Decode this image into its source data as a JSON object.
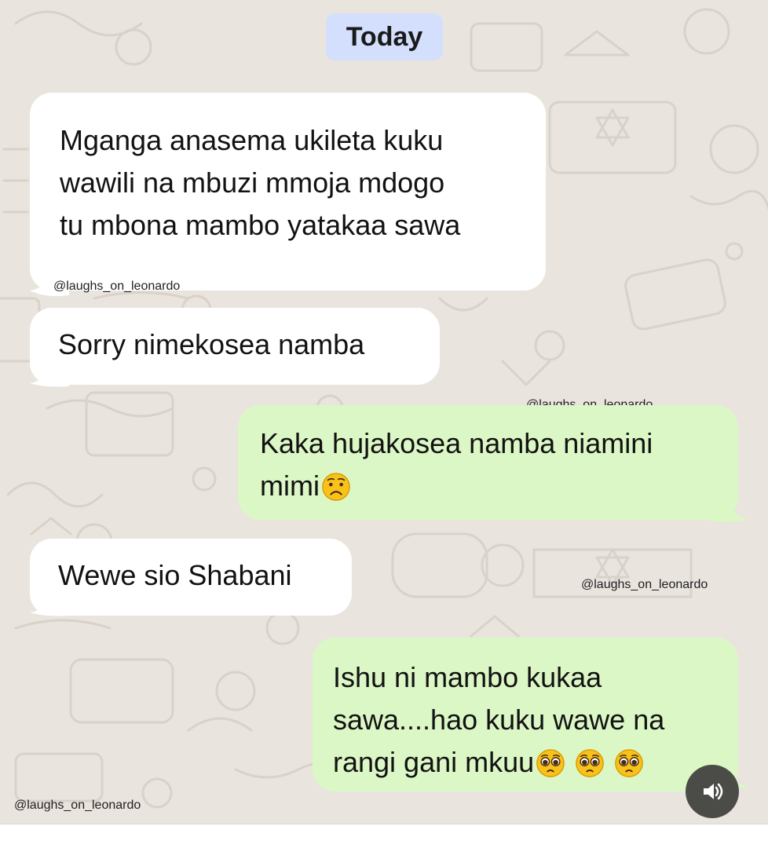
{
  "date_chip": "Today",
  "watermark": "@laughs_on_leonardo",
  "messages": [
    {
      "direction": "incoming",
      "text": "Mganga anasema ukileta kuku\nwawili na mbuzi mmoja mdogo\ntu mbona mambo yatakaa sawa",
      "watermark": "@laughs_on_leonardo"
    },
    {
      "direction": "incoming",
      "text": "Sorry nimekosea namba"
    },
    {
      "direction": "outgoing",
      "text": "Kaka hujakosea namba niamini\nmimi",
      "emoji": [
        "worried-face"
      ]
    },
    {
      "direction": "incoming",
      "text": "Wewe sio Shabani"
    },
    {
      "direction": "outgoing",
      "text": "Ishu ni mambo kukaa\nsawa....hao kuku wawe na\nrangi gani mkuu",
      "emoji": [
        "pleading-face",
        "pleading-face",
        "pleading-face"
      ]
    }
  ],
  "colors": {
    "wallpaper": "#e9e4de",
    "incoming_bubble": "#ffffff",
    "outgoing_bubble": "#dcf7c6",
    "date_chip": "#d3dffc",
    "sound_button": "#4b4b47"
  },
  "controls": {
    "sound_icon": "speaker-icon"
  }
}
